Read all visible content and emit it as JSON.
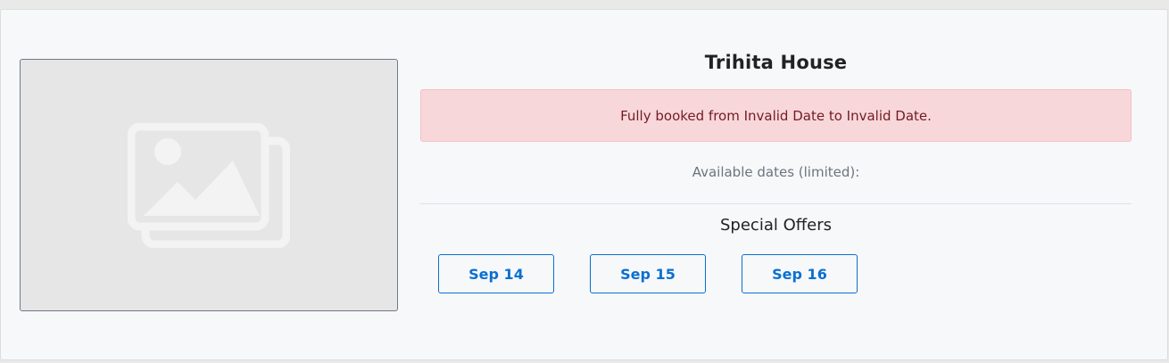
{
  "listing": {
    "title": "Trihita House",
    "image_icon": "image-placeholder-icon"
  },
  "alert": {
    "message": "Fully booked from Invalid Date to Invalid Date."
  },
  "availability": {
    "label": "Available dates (limited):"
  },
  "offers": {
    "heading": "Special Offers",
    "dates": [
      "Sep 14",
      "Sep 15",
      "Sep 16"
    ]
  },
  "colors": {
    "accent": "#0a6fd1",
    "alert_background": "#f8d7da",
    "alert_text": "#721c24"
  }
}
